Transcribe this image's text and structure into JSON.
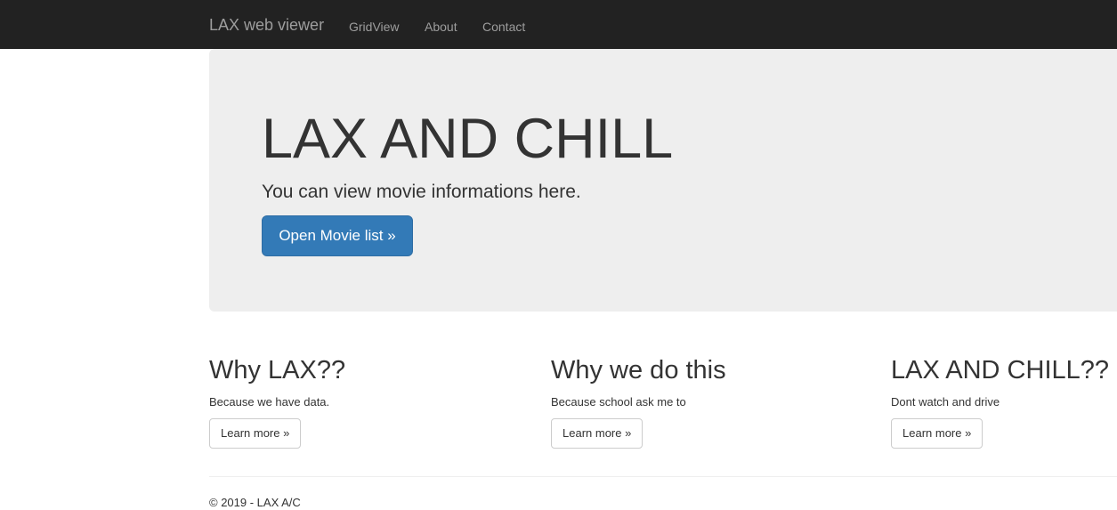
{
  "navbar": {
    "brand": "LAX web viewer",
    "links": [
      {
        "label": "GridView"
      },
      {
        "label": "About"
      },
      {
        "label": "Contact"
      }
    ]
  },
  "hero": {
    "title": "LAX AND CHILL",
    "lead": "You can view movie informations here.",
    "button_label": "Open Movie list »"
  },
  "columns": [
    {
      "heading": "Why LAX??",
      "text": "Because we have data.",
      "button_label": "Learn more »"
    },
    {
      "heading": "Why we do this",
      "text": "Because school ask me to",
      "button_label": "Learn more »"
    },
    {
      "heading": "LAX AND CHILL??",
      "text": "Dont watch and drive",
      "button_label": "Learn more »"
    }
  ],
  "footer": {
    "text": "© 2019 - LAX A/C"
  },
  "colors": {
    "navbar_bg": "#222222",
    "nav_text": "#9d9d9d",
    "jumbotron_bg": "#eeeeee",
    "primary_button": "#337ab7"
  }
}
